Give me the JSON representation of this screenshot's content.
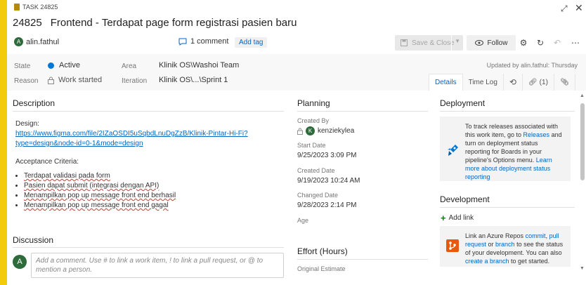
{
  "header": {
    "task_label": "TASK 24825",
    "id": "24825",
    "title": "Frontend - Terdapat page form registrasi pasien baru",
    "owner_initial": "A",
    "owner": "alin.fathul",
    "comments": "1 comment",
    "add_tag": "Add tag",
    "save_close": "Save & Close",
    "follow": "Follow",
    "updated_by": "Updated by alin.fathul: Thursday"
  },
  "fields": {
    "state_label": "State",
    "state_value": "Active",
    "state_color": "#0078d4",
    "reason_label": "Reason",
    "reason_value": "Work started",
    "area_label": "Area",
    "area_value": "Klinik OS\\Washoi Team",
    "iteration_label": "Iteration",
    "iteration_value": "Klinik OS\\...\\Sprint 1"
  },
  "tabs": {
    "details": "Details",
    "time_log": "Time Log",
    "links": "(1)"
  },
  "description": {
    "heading": "Description",
    "design_label": "Design:",
    "design_link_1": "https://www.figma.com/file/2IZaOSDI5uSqbdLnuDgZzB/Klinik-Pintar-Hi-Fi?",
    "design_link_2": "type=design&node-id=0-1&mode=design",
    "criteria_label": "Acceptance Criteria:",
    "criteria": [
      "Terdapat validasi pada form",
      "Pasien dapat submit (integrasi dengan API)",
      "Menampilkan pop up message front end berhasil",
      "Menampilkan pop up message front end gagal"
    ]
  },
  "discussion": {
    "heading": "Discussion",
    "avatar_initial": "A",
    "placeholder": "Add a comment. Use # to link a work item, ! to link a pull request, or @ to mention a person."
  },
  "planning": {
    "heading": "Planning",
    "created_by_label": "Created By",
    "created_by_initial": "K",
    "created_by": "kenziekylea",
    "start_date_label": "Start Date",
    "start_date": "9/25/2023 3:09 PM",
    "created_date_label": "Created Date",
    "created_date": "9/19/2023 10:24 AM",
    "changed_date_label": "Changed Date",
    "changed_date": "9/28/2023 2:14 PM",
    "age_label": "Age",
    "effort_heading": "Effort (Hours)",
    "original_estimate_label": "Original Estimate"
  },
  "deployment": {
    "heading": "Deployment",
    "text_1": "To track releases associated with this work item, go to ",
    "releases_link": "Releases",
    "text_2": " and turn on deployment status reporting for Boards in your pipeline's Options menu. ",
    "learn_link": "Learn more about deployment status reporting"
  },
  "development": {
    "heading": "Development",
    "add_link": "Add link",
    "text_1": "Link an Azure Repos ",
    "commit_link": "commit",
    "text_2": ", ",
    "pull_link": "pull request",
    "text_3": " or ",
    "branch_link": "branch",
    "text_4": " to see the status of your development. You can also ",
    "create_branch_link": "create a branch",
    "text_5": " to get started."
  }
}
